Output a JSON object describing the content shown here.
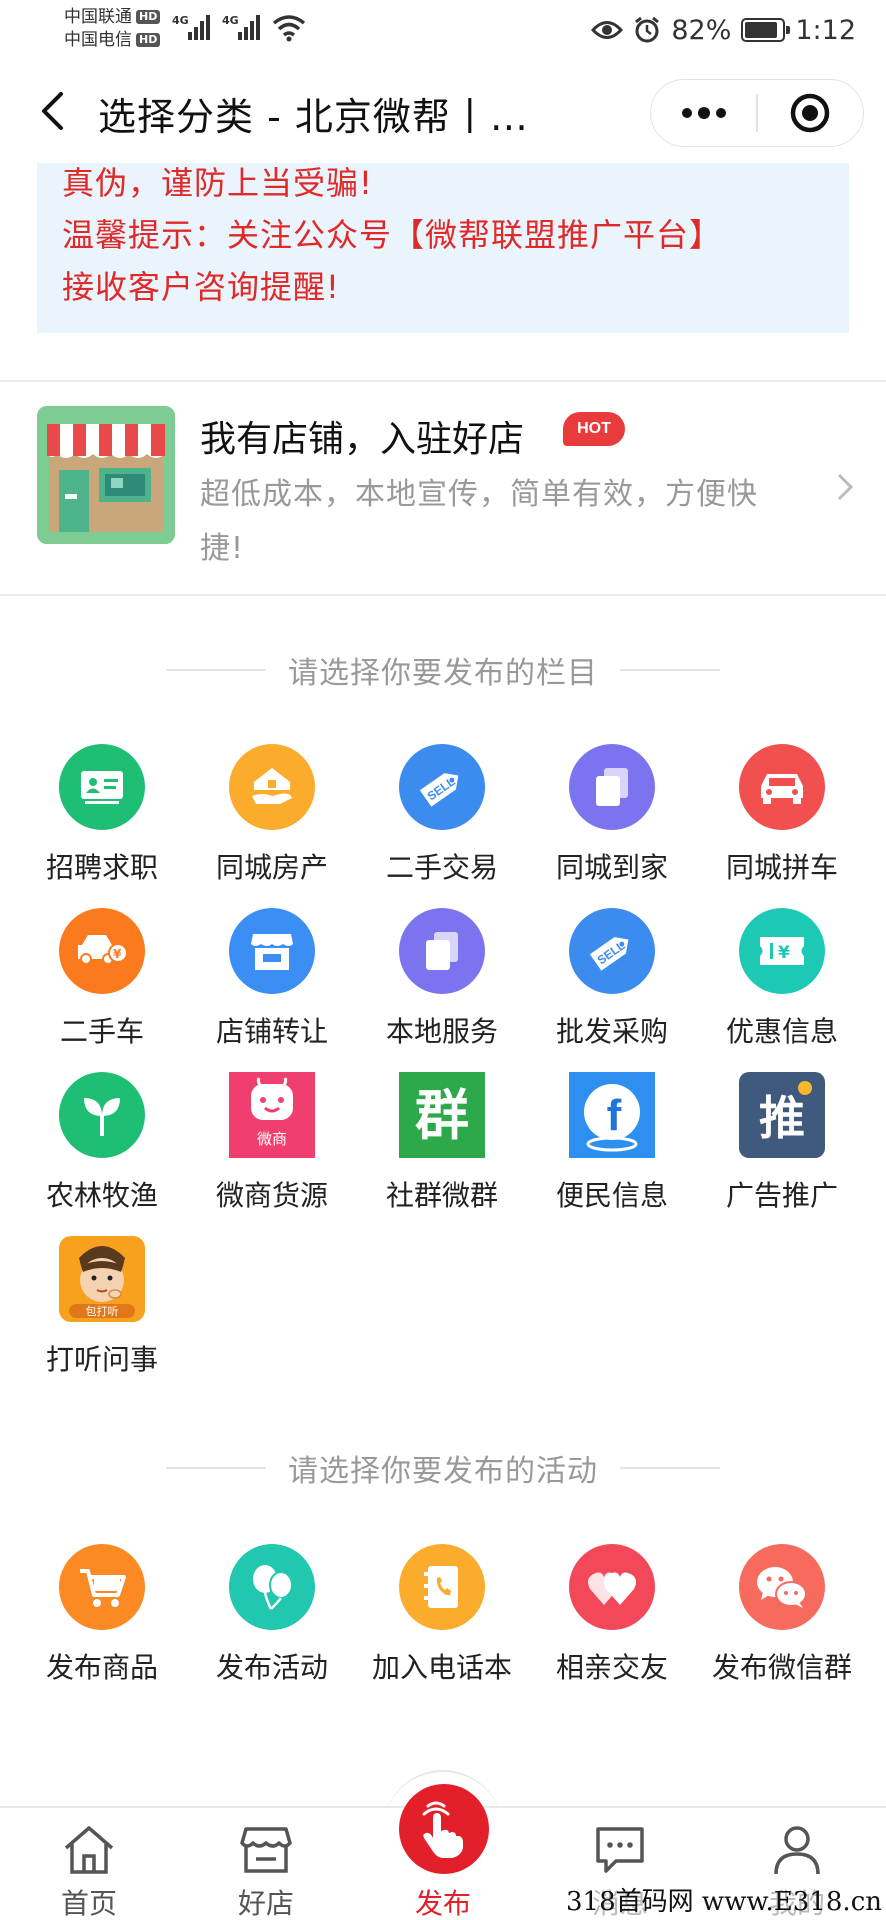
{
  "status_bar": {
    "carrier1": "中国联通",
    "carrier2": "中国电信",
    "hd": "HD",
    "net1": "4G",
    "net2": "4G",
    "battery": "82%",
    "time": "1:12"
  },
  "nav": {
    "title": "选择分类 - 北京微帮丨…"
  },
  "notice": {
    "lines": [
      "真伪，谨防上当受骗!",
      "温馨提示：关注公众号【微帮联盟推广平台】",
      "接收客户咨询提醒!"
    ]
  },
  "promo": {
    "title": "我有店铺，入驻好店",
    "badge": "HOT",
    "desc": "超低成本，本地宣传，简单有效，方便快捷!"
  },
  "columns_section": {
    "header": "请选择你要发布的栏目",
    "items": [
      {
        "label": "招聘求职",
        "icon": "id-card-icon",
        "color": "#1fbe75"
      },
      {
        "label": "同城房产",
        "icon": "house-icon",
        "color": "#fbac2c"
      },
      {
        "label": "二手交易",
        "icon": "sell-tag-icon",
        "color": "#3c8cf0"
      },
      {
        "label": "同城到家",
        "icon": "copy-icon",
        "color": "#7b74ee"
      },
      {
        "label": "同城拼车",
        "icon": "car-icon",
        "color": "#f24f4f"
      },
      {
        "label": "二手车",
        "icon": "car-price-icon",
        "color": "#fb7a1e"
      },
      {
        "label": "店铺转让",
        "icon": "shop-icon",
        "color": "#3b8ef3"
      },
      {
        "label": "本地服务",
        "icon": "copy-icon",
        "color": "#7b74ee"
      },
      {
        "label": "批发采购",
        "icon": "sell-tag-icon",
        "color": "#3c8cf0"
      },
      {
        "label": "优惠信息",
        "icon": "coupon-icon",
        "color": "#1dc9b5"
      },
      {
        "label": "农林牧渔",
        "icon": "sprout-icon",
        "color": "#1fbe75"
      },
      {
        "label": "微商货源",
        "icon": "weishang-logo-icon",
        "color": "#f03f6e",
        "logo_text": "微商"
      },
      {
        "label": "社群微群",
        "icon": "group-logo-icon",
        "color": "#2da84a",
        "logo_text": "群"
      },
      {
        "label": "便民信息",
        "icon": "f-logo-icon",
        "color": "#1f76d6",
        "logo_text": "f"
      },
      {
        "label": "广告推广",
        "icon": "promote-logo-icon",
        "color": "#3f5a7d",
        "logo_text": "推"
      },
      {
        "label": "打听问事",
        "icon": "inquiry-avatar-icon",
        "color": "#f8a11e",
        "logo_text": "包打听"
      }
    ]
  },
  "activities_section": {
    "header": "请选择你要发布的活动",
    "items": [
      {
        "label": "发布商品",
        "icon": "cart-icon",
        "color": "#fb8a25"
      },
      {
        "label": "发布活动",
        "icon": "balloon-icon",
        "color": "#22c7b0"
      },
      {
        "label": "加入电话本",
        "icon": "phonebook-icon",
        "color": "#fbac2c"
      },
      {
        "label": "相亲交友",
        "icon": "hearts-icon",
        "color": "#f2485a"
      },
      {
        "label": "发布微信群",
        "icon": "wechat-icon",
        "color": "#f76a5e"
      }
    ]
  },
  "tabbar": {
    "items": [
      {
        "label": "首页",
        "icon": "home-icon"
      },
      {
        "label": "好店",
        "icon": "shop-icon"
      },
      {
        "label": "发布",
        "icon": "tap-hand-icon"
      },
      {
        "label": "消息",
        "icon": "message-icon"
      },
      {
        "label": "我的",
        "icon": "user-icon"
      }
    ],
    "accent": "#e3202a"
  },
  "watermark": "318首码网 www.E318.cn"
}
